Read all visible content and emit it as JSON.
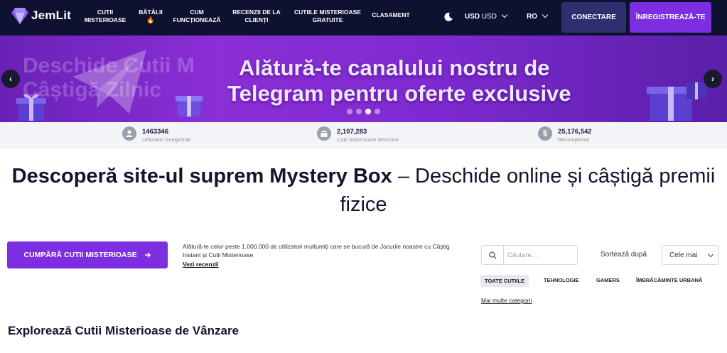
{
  "brand": {
    "name": "JemLit"
  },
  "nav": {
    "items": [
      {
        "label": "Cutii misterioase"
      },
      {
        "label": "Bătălii"
      },
      {
        "label": "Cum funcționează"
      },
      {
        "label": "Recenzii de la clienți"
      },
      {
        "label": "Cutiile misterioase gratuite"
      },
      {
        "label": "Clasament"
      }
    ],
    "currency_code": "USD",
    "currency_label": "USD",
    "language": "RO",
    "login_label": "Conectare",
    "register_label": "Înregistrează-te"
  },
  "banner": {
    "line1": "Alătură-te canalului nostru de",
    "line2": "Telegram pentru oferte exclusive",
    "ghost_line1": "Deschide Cutii M",
    "ghost_line2": "Câștigă Zilnic",
    "slide_count": 4,
    "active_slide": 3,
    "prev_icon": "‹",
    "next_icon": "›"
  },
  "stats": [
    {
      "value": "1463346",
      "label": "Utilizatori înregistrați",
      "icon": "user-icon"
    },
    {
      "value": "2,107,283",
      "label": "Cutii misterioase deschise",
      "icon": "box-icon"
    },
    {
      "value": "25,176,542",
      "label": "Recompense",
      "icon": "dollar-icon"
    }
  ],
  "hero": {
    "headline_bold": "Descoperă site-ul suprem Mystery Box",
    "headline_rest": " – Deschide online și câștigă premii fizice"
  },
  "cta": {
    "buy_label": "Cumpără cutii misterioase",
    "blurb": "Alătură-te celor peste 1.000.000 de utilizatori mulțumiți care se bucură de Jocurile noastre cu Câștig Instant și Cutii Misterioase",
    "reviews_link": "Vezi recenzii"
  },
  "filters": {
    "search_placeholder": "Căutare...",
    "sort_label": "Sortează după",
    "sort_value": "Cele mai",
    "categories": [
      {
        "label": "Toate cutiile",
        "active": true
      },
      {
        "label": "Tehnologie",
        "active": false
      },
      {
        "label": "Gamers",
        "active": false
      },
      {
        "label": "Îmbrăcăminte urbană",
        "active": false
      }
    ],
    "more_categories": "Mai multe categorii"
  },
  "section": {
    "title": "Explorează Cutii Misterioase de Vânzare"
  },
  "colors": {
    "nav_bg": "#0e1230",
    "accent": "#7c2ee0",
    "login_bg": "#2d2f6e",
    "banner": "#7e2ad0"
  }
}
